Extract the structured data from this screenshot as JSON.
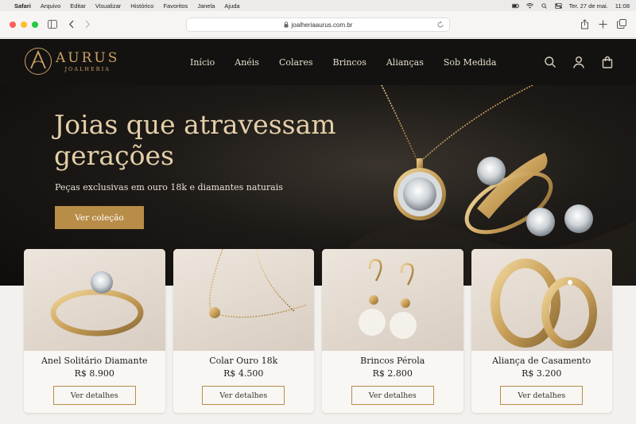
{
  "menubar": {
    "app": "Safari",
    "items": [
      "Arquivo",
      "Editar",
      "Visualizar",
      "Histórico",
      "Favoritos",
      "Janela",
      "Ajuda"
    ],
    "datetime": "Ter. 27 de mai.",
    "time": "11:08"
  },
  "browser": {
    "url": "joalheriaaurus.com.br"
  },
  "site": {
    "brand": "AURUS",
    "brand_sub": "JOALHERIA",
    "nav": [
      "Início",
      "Anéis",
      "Colares",
      "Brincos",
      "Alianças",
      "Sob Medida"
    ]
  },
  "hero": {
    "title": "Joias que atravessam gerações",
    "subtitle": "Peças exclusivas em ouro 18k e diamantes naturais",
    "cta": "Ver coleção"
  },
  "products": [
    {
      "name": "Anel Solitário Diamante",
      "price": "R$ 8.900",
      "cta": "Ver detalhes"
    },
    {
      "name": "Colar Ouro 18k",
      "price": "R$ 4.500",
      "cta": "Ver detalhes"
    },
    {
      "name": "Brincos Pérola",
      "price": "R$ 2.800",
      "cta": "Ver detalhes"
    },
    {
      "name": "Aliança de Casamento",
      "price": "R$ 3.200",
      "cta": "Ver detalhes"
    }
  ],
  "colors": {
    "gold": "#b88d48",
    "header_bg": "#141210",
    "hero_title": "#e3cfa9"
  }
}
